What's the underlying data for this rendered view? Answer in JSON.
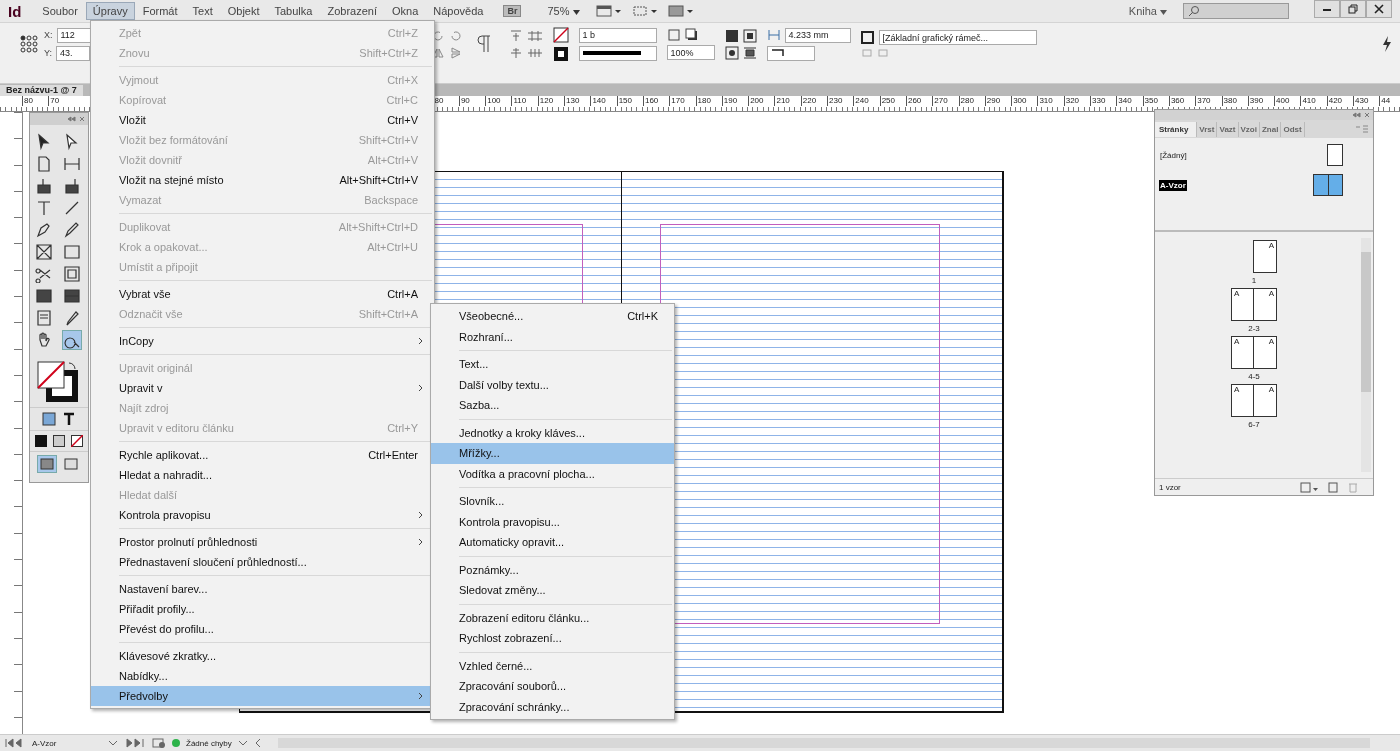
{
  "app": {
    "logo": "Id"
  },
  "menubar": {
    "menus": [
      {
        "label": "Soubor",
        "selected": false
      },
      {
        "label": "Úpravy",
        "selected": true
      },
      {
        "label": "Formát",
        "selected": false
      },
      {
        "label": "Text",
        "selected": false
      },
      {
        "label": "Objekt",
        "selected": false
      },
      {
        "label": "Tabulka",
        "selected": false
      },
      {
        "label": "Zobrazení",
        "selected": false
      },
      {
        "label": "Okna",
        "selected": false
      },
      {
        "label": "Nápověda",
        "selected": false
      }
    ],
    "bridge": "Br",
    "zoom": "75%",
    "workspace": "Kniha"
  },
  "control_bar": {
    "x_label": "X:",
    "x_value": "112",
    "y_label": "Y:",
    "y_value": "43.",
    "stroke_weight": "1 b",
    "opacity": "100%",
    "gutter": "4.233 mm",
    "object_style": "[Základní grafický rámeč..."
  },
  "document": {
    "tab": "Bez názvu-1 @ 7"
  },
  "ruler": {
    "left_labels": [
      "80",
      "70"
    ],
    "labels": [
      "80",
      "90",
      "100",
      "110",
      "120",
      "130",
      "140",
      "150",
      "160",
      "170",
      "180",
      "190",
      "200",
      "210",
      "220",
      "230",
      "240",
      "250",
      "260",
      "270",
      "280",
      "290",
      "300",
      "310",
      "320",
      "330",
      "340",
      "350",
      "360",
      "370",
      "380",
      "390",
      "400",
      "410",
      "420",
      "430",
      "44"
    ]
  },
  "edit_menu": {
    "groups": [
      [
        {
          "label": "Zpět",
          "shortcut": "Ctrl+Z",
          "disabled": true,
          "selected": false,
          "submenu": false
        },
        {
          "label": "Znovu",
          "shortcut": "Shift+Ctrl+Z",
          "disabled": true,
          "selected": false,
          "submenu": false
        }
      ],
      [
        {
          "label": "Vyjmout",
          "shortcut": "Ctrl+X",
          "disabled": true,
          "selected": false,
          "submenu": false
        },
        {
          "label": "Kopírovat",
          "shortcut": "Ctrl+C",
          "disabled": true,
          "selected": false,
          "submenu": false
        },
        {
          "label": "Vložit",
          "shortcut": "Ctrl+V",
          "disabled": false,
          "selected": false,
          "submenu": false
        },
        {
          "label": "Vložit bez formátování",
          "shortcut": "Shift+Ctrl+V",
          "disabled": true,
          "selected": false,
          "submenu": false
        },
        {
          "label": "Vložit dovnitř",
          "shortcut": "Alt+Ctrl+V",
          "disabled": true,
          "selected": false,
          "submenu": false
        },
        {
          "label": "Vložit na stejné místo",
          "shortcut": "Alt+Shift+Ctrl+V",
          "disabled": false,
          "selected": false,
          "submenu": false
        },
        {
          "label": "Vymazat",
          "shortcut": "Backspace",
          "disabled": true,
          "selected": false,
          "submenu": false
        }
      ],
      [
        {
          "label": "Duplikovat",
          "shortcut": "Alt+Shift+Ctrl+D",
          "disabled": true,
          "selected": false,
          "submenu": false
        },
        {
          "label": "Krok a opakovat...",
          "shortcut": "Alt+Ctrl+U",
          "disabled": true,
          "selected": false,
          "submenu": false
        },
        {
          "label": "Umístit a připojit",
          "disabled": true,
          "selected": false,
          "submenu": false
        }
      ],
      [
        {
          "label": "Vybrat vše",
          "shortcut": "Ctrl+A",
          "disabled": false,
          "selected": false,
          "submenu": false
        },
        {
          "label": "Odznačit vše",
          "shortcut": "Shift+Ctrl+A",
          "disabled": true,
          "selected": false,
          "submenu": false
        }
      ],
      [
        {
          "label": "InCopy",
          "disabled": false,
          "selected": false,
          "submenu": true
        }
      ],
      [
        {
          "label": "Upravit originál",
          "disabled": true,
          "selected": false,
          "submenu": false
        },
        {
          "label": "Upravit v",
          "disabled": false,
          "selected": false,
          "submenu": true
        },
        {
          "label": "Najít zdroj",
          "disabled": true,
          "selected": false,
          "submenu": false
        },
        {
          "label": "Upravit v editoru článku",
          "shortcut": "Ctrl+Y",
          "disabled": true,
          "selected": false,
          "submenu": false
        }
      ],
      [
        {
          "label": "Rychle aplikovat...",
          "shortcut": "Ctrl+Enter",
          "disabled": false,
          "selected": false,
          "submenu": false
        },
        {
          "label": "Hledat a nahradit...",
          "disabled": false,
          "selected": false,
          "submenu": false
        },
        {
          "label": "Hledat další",
          "disabled": true,
          "selected": false,
          "submenu": false
        },
        {
          "label": "Kontrola pravopisu",
          "disabled": false,
          "selected": false,
          "submenu": true
        }
      ],
      [
        {
          "label": "Prostor prolnutí průhlednosti",
          "disabled": false,
          "selected": false,
          "submenu": true
        },
        {
          "label": "Přednastavení sloučení průhledností...",
          "disabled": false,
          "selected": false,
          "submenu": false
        }
      ],
      [
        {
          "label": "Nastavení barev...",
          "disabled": false,
          "selected": false,
          "submenu": false
        },
        {
          "label": "Přiřadit profily...",
          "disabled": false,
          "selected": false,
          "submenu": false
        },
        {
          "label": "Převést do profilu...",
          "disabled": false,
          "selected": false,
          "submenu": false
        }
      ],
      [
        {
          "label": "Klávesové zkratky...",
          "disabled": false,
          "selected": false,
          "submenu": false
        },
        {
          "label": "Nabídky...",
          "disabled": false,
          "selected": false,
          "submenu": false
        },
        {
          "label": "Předvolby",
          "disabled": false,
          "selected": true,
          "submenu": true
        }
      ]
    ]
  },
  "preferences_menu": {
    "groups": [
      [
        {
          "label": "Všeobecné...",
          "shortcut": "Ctrl+K",
          "selected": false
        },
        {
          "label": "Rozhraní...",
          "selected": false
        }
      ],
      [
        {
          "label": "Text...",
          "selected": false
        },
        {
          "label": "Další volby textu...",
          "selected": false
        },
        {
          "label": "Sazba...",
          "selected": false
        }
      ],
      [
        {
          "label": "Jednotky a kroky kláves...",
          "selected": false
        },
        {
          "label": "Mřížky...",
          "selected": true
        },
        {
          "label": "Vodítka a pracovní plocha...",
          "selected": false
        }
      ],
      [
        {
          "label": "Slovník...",
          "selected": false
        },
        {
          "label": "Kontrola pravopisu...",
          "selected": false
        },
        {
          "label": "Automaticky opravit...",
          "selected": false
        }
      ],
      [
        {
          "label": "Poznámky...",
          "selected": false
        },
        {
          "label": "Sledovat změny...",
          "selected": false
        }
      ],
      [
        {
          "label": "Zobrazení editoru článku...",
          "selected": false
        },
        {
          "label": "Rychlost zobrazení...",
          "selected": false
        }
      ],
      [
        {
          "label": "Vzhled černé...",
          "selected": false
        },
        {
          "label": "Zpracování souborů...",
          "selected": false
        },
        {
          "label": "Zpracování schránky...",
          "selected": false
        }
      ]
    ]
  },
  "pages_panel": {
    "tabs": [
      {
        "label": "Stránky",
        "selected": true
      },
      {
        "label": "Vrst",
        "selected": false
      },
      {
        "label": "Vazt",
        "selected": false
      },
      {
        "label": "Vzoi",
        "selected": false
      },
      {
        "label": "Znal",
        "selected": false
      },
      {
        "label": "Odst",
        "selected": false
      }
    ],
    "masters": [
      {
        "label": "[Žádný]",
        "selected": false,
        "kind": "single"
      },
      {
        "label": "A-Vzor",
        "selected": true,
        "kind": "spread"
      }
    ],
    "spreads": [
      {
        "label": "1",
        "pages": [
          "A"
        ]
      },
      {
        "label": "2-3",
        "pages": [
          "A",
          "A"
        ]
      },
      {
        "label": "4-5",
        "pages": [
          "A",
          "A"
        ]
      },
      {
        "label": "6-7",
        "pages": [
          "A",
          "A"
        ]
      }
    ],
    "footer": "1 vzor"
  },
  "status_bar": {
    "page": "A-Vzor",
    "preflight": "Žádné chyby",
    "preflight_ok": true
  }
}
